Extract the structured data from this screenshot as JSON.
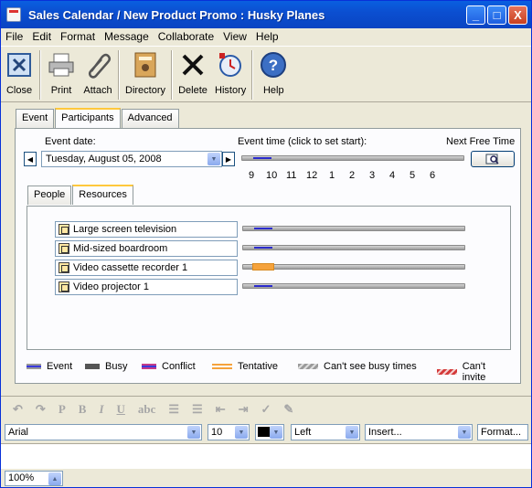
{
  "window": {
    "title": "Sales Calendar / New Product Promo : Husky Planes",
    "minimize": "_",
    "maximize": "□",
    "close": "X"
  },
  "menu": [
    "File",
    "Edit",
    "Format",
    "Message",
    "Collaborate",
    "View",
    "Help"
  ],
  "toolbar": {
    "close": "Close",
    "print": "Print",
    "attach": "Attach",
    "directory": "Directory",
    "delete": "Delete",
    "history": "History",
    "help": "Help"
  },
  "tabs": [
    "Event",
    "Participants",
    "Advanced"
  ],
  "active_tab": "Participants",
  "event_date_label": "Event date:",
  "event_date_value": "Tuesday, August 05, 2008",
  "event_time_label": "Event time (click to set start):",
  "next_free_label": "Next Free Time",
  "hours": [
    "9",
    "10",
    "11",
    "12",
    "1",
    "2",
    "3",
    "4",
    "5",
    "6"
  ],
  "subtabs": [
    "People",
    "Resources"
  ],
  "active_subtab": "Resources",
  "resources": [
    {
      "name": "Large screen television",
      "status": "event"
    },
    {
      "name": "Mid-sized boardroom",
      "status": "event"
    },
    {
      "name": "Video cassette recorder 1",
      "status": "tentative"
    },
    {
      "name": "Video projector 1",
      "status": "event"
    }
  ],
  "legend": [
    {
      "label": "Event",
      "color": "#3a3adc"
    },
    {
      "label": "Busy",
      "color": "#555555"
    },
    {
      "label": "Conflict",
      "color": "#c43c8a"
    },
    {
      "label": "Tentative",
      "color": "#f5a23c"
    },
    {
      "label": "Can't see busy times",
      "color": "#9a9a9a"
    },
    {
      "label": "Can't invite",
      "color": "#d43a3a"
    }
  ],
  "format": {
    "font": "Arial",
    "size": "10",
    "align": "Left",
    "insert": "Insert...",
    "format": "Format..."
  },
  "zoom": "100%"
}
